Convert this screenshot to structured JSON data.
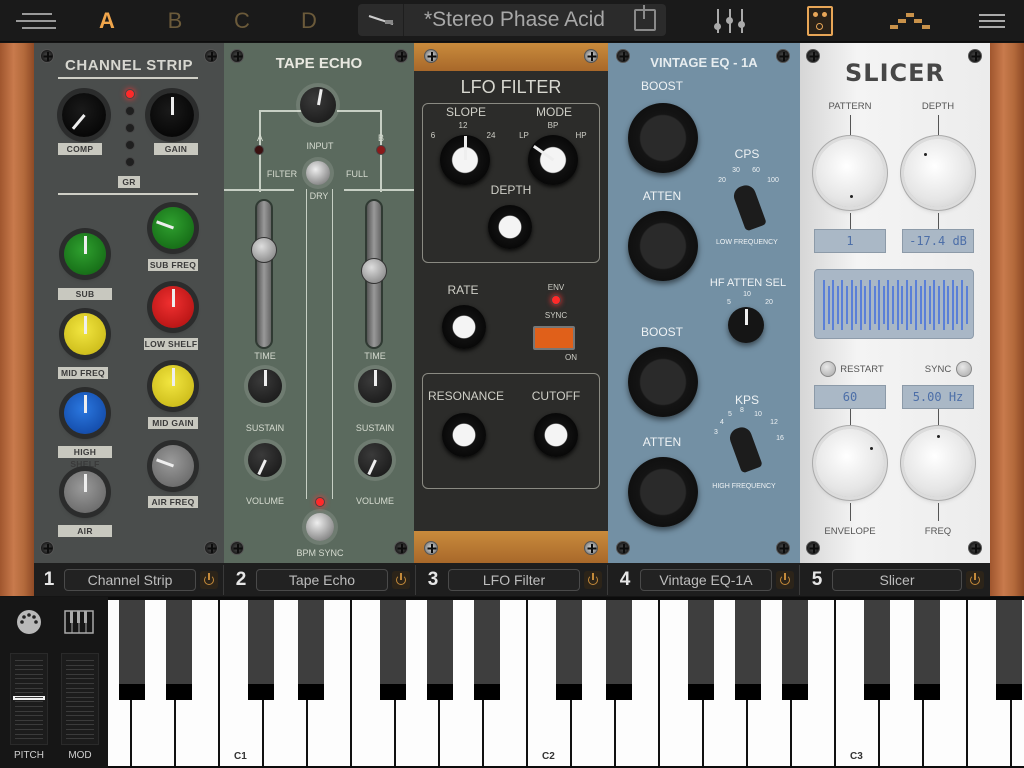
{
  "topbar": {
    "menu_icon": "menu-lines-icon",
    "presets": [
      {
        "label": "A",
        "active": true
      },
      {
        "label": "B",
        "active": false
      },
      {
        "label": "C",
        "active": false
      },
      {
        "label": "D",
        "active": false
      }
    ],
    "preset_name": "*Stereo Phase Acid",
    "cable_icon": "cable-icon",
    "save_icon": "save-icon",
    "mixer_icon": "mixer-icon",
    "pedal_icon": "pedal-icon",
    "stack_icon": "stack-icon",
    "settings_icon": "hamburger-icon",
    "accent_color": "#f0a54b"
  },
  "modules": {
    "channel_strip": {
      "title": "CHANNEL STRIP",
      "labels": {
        "comp": "COMP",
        "gain": "GAIN",
        "gr": "GR",
        "sub": "SUB",
        "sub_freq": "SUB FREQ",
        "low_shelf": "LOW SHELF",
        "mid_freq": "MID FREQ",
        "mid_gain": "MID GAIN",
        "high_shelf": "HIGH SHELF",
        "air_freq": "AIR FREQ",
        "air": "AIR"
      },
      "gr_leds_lit": 1,
      "gr_leds_total": 5
    },
    "tape_echo": {
      "title": "TAPE ECHO",
      "labels": {
        "input": "INPUT",
        "a": "A",
        "b": "B",
        "filter": "FILTER",
        "full": "FULL",
        "dry": "DRY",
        "time": "TIME",
        "sustain": "SUSTAIN",
        "volume": "VOLUME",
        "bpm_sync": "BPM SYNC"
      }
    },
    "lfo_filter": {
      "title": "LFO FILTER",
      "labels": {
        "slope": "SLOPE",
        "mode": "MODE",
        "depth": "DEPTH",
        "rate": "RATE",
        "env": "ENV",
        "sync": "SYNC",
        "on": "ON",
        "resonance": "RESONANCE",
        "cutoff": "CUTOFF"
      },
      "slope_ticks": [
        "6",
        "12",
        "24"
      ],
      "mode_ticks": [
        "LP",
        "BP",
        "HP"
      ],
      "slope_value": "12",
      "mode_value": "LP"
    },
    "vintage_eq": {
      "title": "VINTAGE EQ - 1A",
      "labels": {
        "boost": "BOOST",
        "atten": "ATTEN",
        "cps": "CPS",
        "low_frequency": "LOW FREQUENCY",
        "hf_atten_sel": "HF ATTEN SEL",
        "kps": "KPS",
        "high_frequency": "HIGH FREQUENCY"
      },
      "cps_ticks": [
        "20",
        "30",
        "60",
        "100"
      ],
      "hf_atten_ticks": [
        "5",
        "10",
        "20"
      ],
      "kps_ticks": [
        "3",
        "4",
        "5",
        "8",
        "10",
        "12",
        "16"
      ]
    },
    "slicer": {
      "title": "SLICER",
      "labels": {
        "pattern": "PATTERN",
        "depth": "DEPTH",
        "restart": "RESTART",
        "sync": "SYNC",
        "envelope": "ENVELOPE",
        "freq": "FREQ"
      },
      "pattern_value": "1",
      "depth_value": "-17.4 dB",
      "envelope_value": "60",
      "freq_value": "5.00 Hz"
    }
  },
  "slots": [
    {
      "num": "1",
      "name": "Channel Strip"
    },
    {
      "num": "2",
      "name": "Tape Echo"
    },
    {
      "num": "3",
      "name": "LFO Filter"
    },
    {
      "num": "4",
      "name": "Vintage EQ-1A"
    },
    {
      "num": "5",
      "name": "Slicer"
    }
  ],
  "keyboard": {
    "midi_icon": "midi-din-icon",
    "keys_icon": "piano-keys-icon",
    "pitch_label": "PITCH",
    "mod_label": "MOD",
    "pitch_value": 0.5,
    "mod_value": 0.0,
    "octave_labels": [
      "C1",
      "C2",
      "C3"
    ]
  }
}
